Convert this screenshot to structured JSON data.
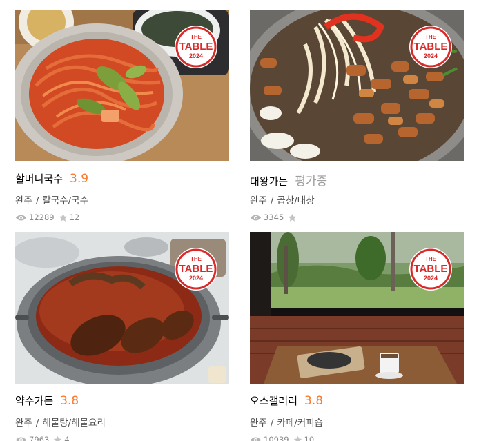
{
  "colors": {
    "rating_orange": "#ff792a",
    "badge_red": "#d92a2a",
    "muted_gray": "#9e9e9e"
  },
  "badge": {
    "line1": "THE",
    "line2": "TABLE",
    "line3": "2024"
  },
  "icons": {
    "views": "eye-icon",
    "favorites": "star-icon"
  },
  "restaurants": [
    {
      "name": "할머니국수",
      "rating": "3.9",
      "region": "완주",
      "separator": "/",
      "category": "칼국수/국수",
      "views": "12289",
      "favorites": "12"
    },
    {
      "name": "대왕가든",
      "rating": "평가중",
      "region": "완주",
      "separator": "/",
      "category": "곱창/대창",
      "views": "3345",
      "favorites": ""
    },
    {
      "name": "약수가든",
      "rating": "3.8",
      "region": "완주",
      "separator": "/",
      "category": "해물탕/해물요리",
      "views": "7963",
      "favorites": "4"
    },
    {
      "name": "오스갤러리",
      "rating": "3.8",
      "region": "완주",
      "separator": "/",
      "category": "카페/커피숍",
      "views": "10939",
      "favorites": "10"
    }
  ]
}
